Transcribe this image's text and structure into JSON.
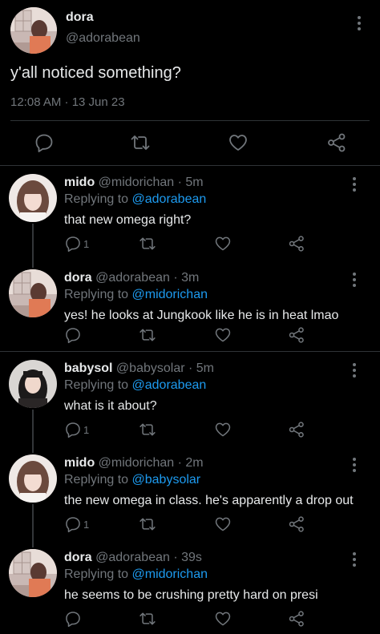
{
  "main_tweet": {
    "name": "dora",
    "handle": "@adorabean",
    "text": "y'all noticed something?",
    "timestamp": "12:08 AM · 13 Jun 23",
    "actions": [
      "reply-icon",
      "retweet-icon",
      "like-icon",
      "share-icon"
    ]
  },
  "replies": [
    {
      "name": "mido",
      "handle": "@midorichan",
      "time": "5m",
      "replying_label": "Replying to",
      "replying_to": "@adorabean",
      "text": "that new omega right?",
      "reply_count": "1",
      "avatar": "girl-bangs-photo"
    },
    {
      "name": "dora",
      "handle": "@adorabean",
      "time": "3m",
      "replying_label": "Replying to",
      "replying_to": "@midorichan",
      "text": "yes! he looks at Jungkook like he is in heat lmao",
      "reply_count": "",
      "avatar": "window-selfie-photo"
    },
    {
      "name": "babysol",
      "handle": "@babysolar",
      "time": "5m",
      "replying_label": "Replying to",
      "replying_to": "@adorabean",
      "text": "what is it about?",
      "reply_count": "1",
      "avatar": "dark-hair-photo"
    },
    {
      "name": "mido",
      "handle": "@midorichan",
      "time": "2m",
      "replying_label": "Replying to",
      "replying_to": "@babysolar",
      "text": "the new omega in class. he's apparently a drop out",
      "reply_count": "1",
      "avatar": "girl-bangs-photo"
    },
    {
      "name": "dora",
      "handle": "@adorabean",
      "time": "39s",
      "replying_label": "Replying to",
      "replying_to": "@midorichan",
      "text": "he seems to be crushing pretty hard on presi",
      "reply_count": "",
      "avatar": "window-selfie-photo"
    }
  ],
  "colors": {
    "background": "#000000",
    "text": "#e7e9ea",
    "secondary": "#71767b",
    "link": "#1d9bf0",
    "divider": "#2f3336"
  }
}
